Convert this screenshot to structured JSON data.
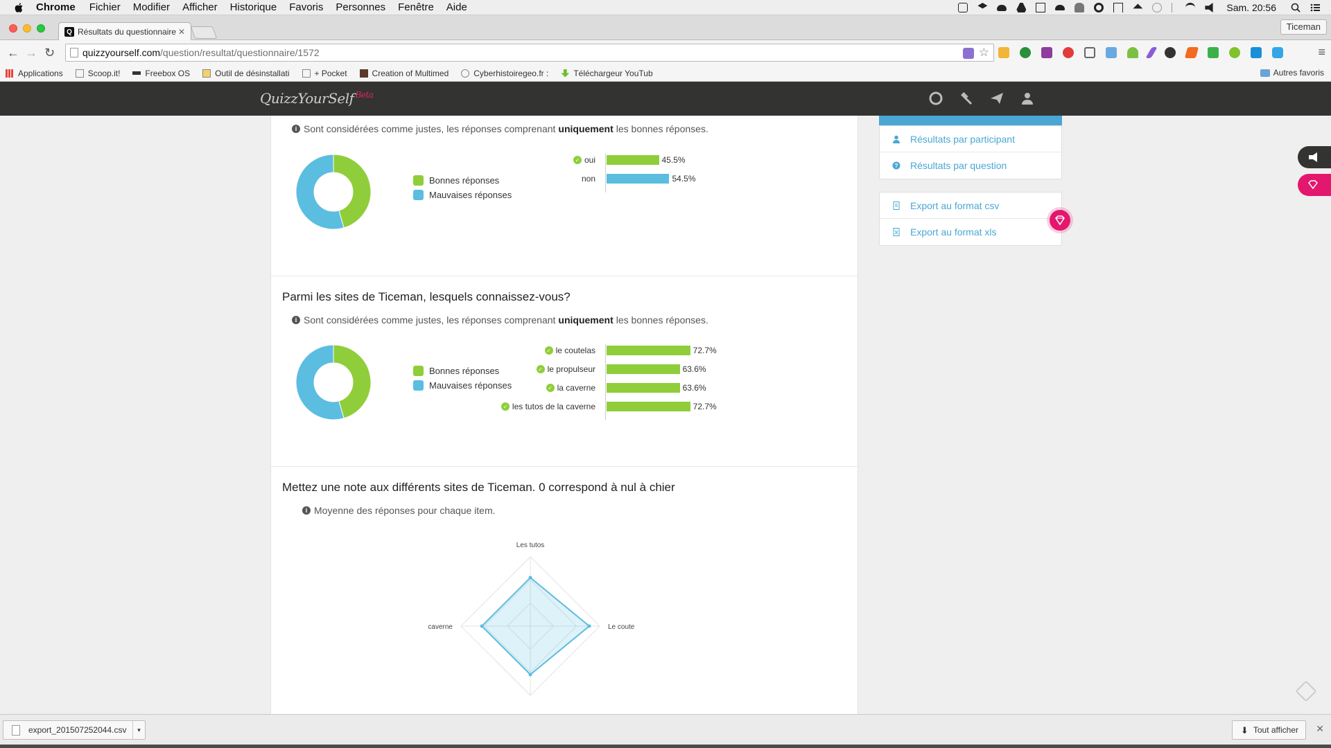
{
  "menubar": {
    "app": "Chrome",
    "items": [
      "Fichier",
      "Modifier",
      "Afficher",
      "Historique",
      "Favoris",
      "Personnes",
      "Fenêtre",
      "Aide"
    ],
    "clock": "Sam. 20:56"
  },
  "browser": {
    "tab_title": "Résultats du questionnaire",
    "profile": "Ticeman",
    "url_host": "quizzyourself.com",
    "url_path": "/question/resultat/questionnaire/1572",
    "bookmarks": [
      "Applications",
      "Scoop.it!",
      "Freebox OS",
      "Outil de désinstallati",
      "+ Pocket",
      "Creation of Multimed",
      "Cyberhistoiregeo.fr :",
      "Téléchargeur YouTub"
    ],
    "bookmarks_other": "Autres favoris"
  },
  "site": {
    "logo": "QuizzYourSelf",
    "logo_badge": "Beta"
  },
  "colors": {
    "good": "#8fce3a",
    "bad": "#5bbde0",
    "accent": "#4aa7d4",
    "brand_pink": "#e4176e",
    "navbar": "#333331"
  },
  "questions": [
    {
      "title": "",
      "note_prefix": "Sont considérées comme justes, les réponses comprenant",
      "note_bold": "uniquement",
      "note_suffix": "les bonnes réponses.",
      "legend": [
        "Bonnes réponses",
        "Mauvaises réponses"
      ],
      "donut_good_fraction": 0.455,
      "bars": [
        {
          "label": "oui",
          "correct": true,
          "value": 45.5,
          "value_label": "45.5%",
          "color": "good"
        },
        {
          "label": "non",
          "correct": false,
          "value": 54.5,
          "value_label": "54.5%",
          "color": "bad"
        }
      ]
    },
    {
      "title": "Parmi les sites de Ticeman, lesquels connaissez-vous?",
      "note_prefix": "Sont considérées comme justes, les réponses comprenant",
      "note_bold": "uniquement",
      "note_suffix": "les bonnes réponses.",
      "legend": [
        "Bonnes réponses",
        "Mauvaises réponses"
      ],
      "donut_good_fraction": 0.455,
      "bars": [
        {
          "label": "le coutelas",
          "correct": true,
          "value": 72.7,
          "value_label": "72.7%",
          "color": "good"
        },
        {
          "label": "le propulseur",
          "correct": true,
          "value": 63.6,
          "value_label": "63.6%",
          "color": "good"
        },
        {
          "label": "la caverne",
          "correct": true,
          "value": 63.6,
          "value_label": "63.6%",
          "color": "good"
        },
        {
          "label": "les tutos de la caverne",
          "correct": true,
          "value": 72.7,
          "value_label": "72.7%",
          "color": "good"
        }
      ]
    },
    {
      "title": "Mettez une note aux différents sites de Ticeman. 0 correspond à nul à chier",
      "note": "Moyenne des réponses pour chaque item.",
      "radar": {
        "axes": [
          "Les tutos",
          "Le coutela",
          "",
          "La caverne"
        ],
        "values": [
          0.7,
          0.85,
          0.7,
          0.7
        ],
        "max": 1
      }
    }
  ],
  "sidebar": {
    "results": [
      "Résultats par participant",
      "Résultats par question"
    ],
    "exports": [
      "Export au format csv",
      "Export au format xls"
    ]
  },
  "downloads": {
    "file": "export_201507252044.csv",
    "show_all": "Tout afficher"
  }
}
